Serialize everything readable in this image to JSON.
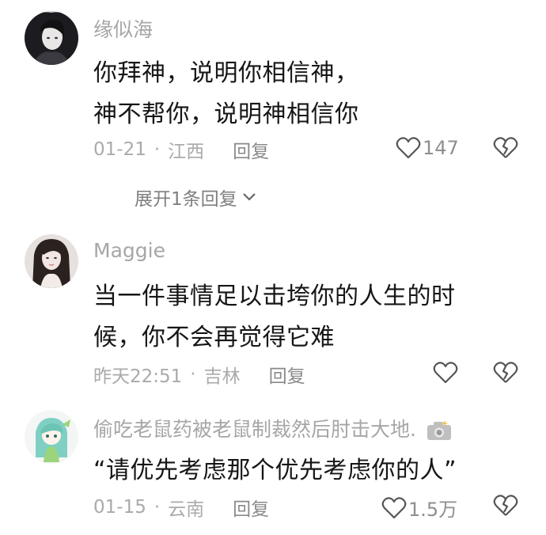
{
  "comments": [
    {
      "username": "缘似海",
      "lines": [
        "你拜神，说明你相信神，",
        "神不帮你，说明神相信你"
      ],
      "date": "01-21",
      "location": "江西",
      "reply_label": "回复",
      "likes": "147",
      "expand_label": "展开1条回复",
      "avatar_icon": "avatar-dark-hair-icon"
    },
    {
      "username": "Maggie",
      "lines": [
        "当一件事情足以击垮你的人生的时",
        "候，你不会再觉得它难"
      ],
      "date": "昨天22:51",
      "location": "吉林",
      "reply_label": "回复",
      "likes": "",
      "avatar_icon": "avatar-girl-icon"
    },
    {
      "username": "偷吃老鼠药被老鼠制裁然后肘击大地.",
      "lines": [
        "“请优先考虑那个优先考虑你的人”"
      ],
      "date": "01-15",
      "location": "云南",
      "reply_label": "回复",
      "likes": "1.5万",
      "avatar_icon": "avatar-green-hair-anime-icon",
      "badge_icon": "camera-icon"
    }
  ],
  "separator": "·",
  "colors": {
    "text": "#161616",
    "muted": "#aaaaaa",
    "icon": "#555555"
  }
}
